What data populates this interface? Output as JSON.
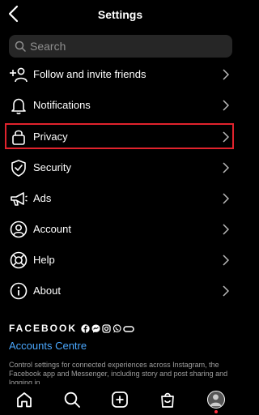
{
  "header": {
    "title": "Settings",
    "back_icon": "chevron-left-icon"
  },
  "search": {
    "placeholder": "Search",
    "value": ""
  },
  "menu": [
    {
      "key": "follow",
      "label": "Follow and invite friends",
      "icon": "add-person-icon"
    },
    {
      "key": "notifications",
      "label": "Notifications",
      "icon": "bell-icon"
    },
    {
      "key": "privacy",
      "label": "Privacy",
      "icon": "lock-icon",
      "highlighted": true
    },
    {
      "key": "security",
      "label": "Security",
      "icon": "shield-check-icon"
    },
    {
      "key": "ads",
      "label": "Ads",
      "icon": "megaphone-icon"
    },
    {
      "key": "account",
      "label": "Account",
      "icon": "person-circle-icon"
    },
    {
      "key": "help",
      "label": "Help",
      "icon": "lifebuoy-icon"
    },
    {
      "key": "about",
      "label": "About",
      "icon": "info-icon"
    }
  ],
  "footer": {
    "brand": "FACEBOOK",
    "brand_icons": [
      "facebook-icon",
      "messenger-icon",
      "instagram-icon",
      "whatsapp-icon",
      "oculus-icon"
    ],
    "accounts_centre": "Accounts Centre",
    "description": "Control settings for connected experiences across Instagram, the Facebook app and Messenger, including story and post sharing and logging in."
  },
  "bottom_nav": [
    "home-icon",
    "search-icon",
    "create-icon",
    "shop-icon",
    "profile-avatar"
  ],
  "colors": {
    "background": "#000000",
    "link": "#4aa8ff",
    "highlight": "#e0232d",
    "notification_dot": "#ff3040"
  }
}
